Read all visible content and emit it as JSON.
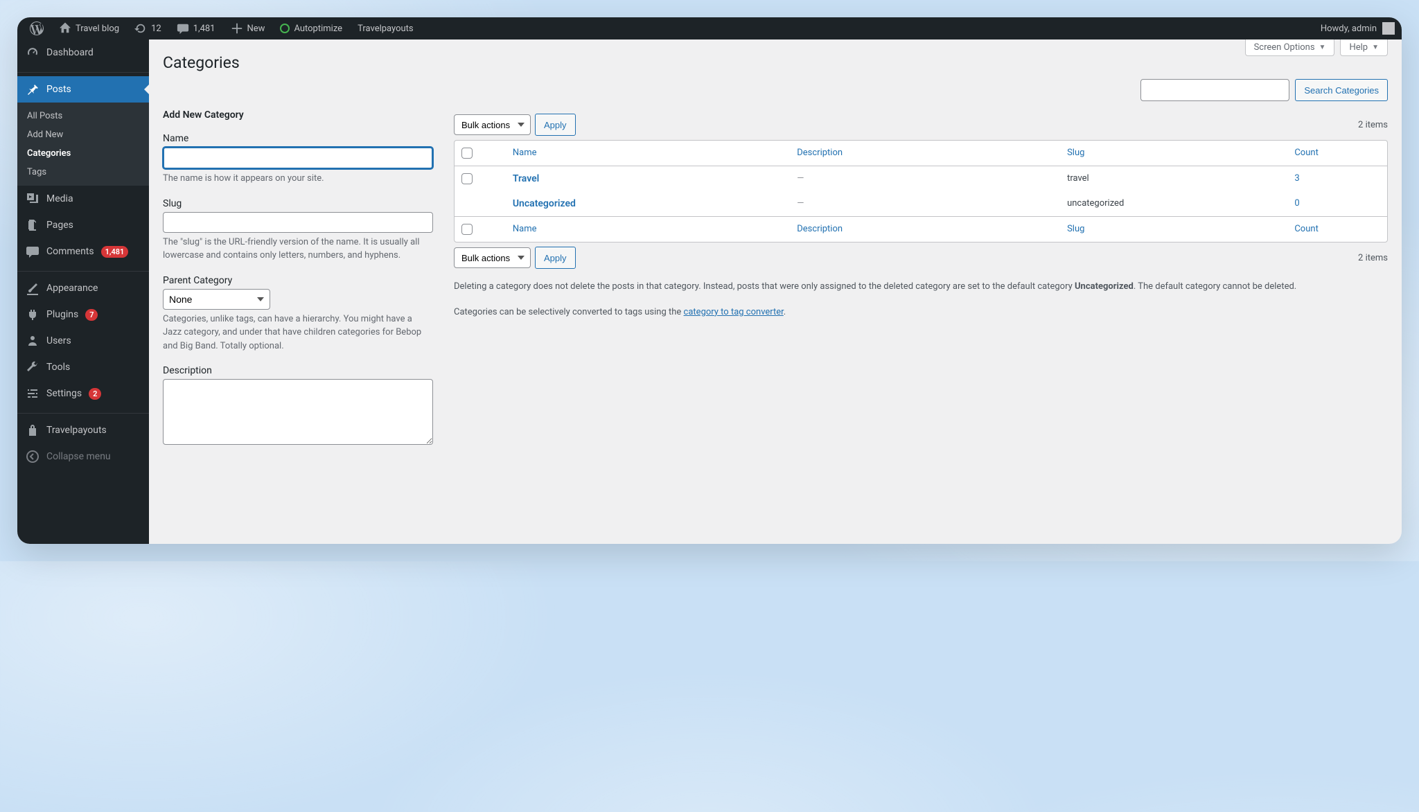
{
  "adminbar": {
    "site_name": "Travel blog",
    "updates_count": "12",
    "comments_count": "1,481",
    "new_label": "New",
    "autoptimize_label": "Autoptimize",
    "travelpayouts_label": "Travelpayouts",
    "howdy": "Howdy, admin"
  },
  "sidebar": {
    "dashboard": "Dashboard",
    "posts": "Posts",
    "posts_submenu": {
      "all": "All Posts",
      "add": "Add New",
      "categories": "Categories",
      "tags": "Tags"
    },
    "media": "Media",
    "pages": "Pages",
    "comments": "Comments",
    "comments_count": "1,481",
    "appearance": "Appearance",
    "plugins": "Plugins",
    "plugins_count": "7",
    "users": "Users",
    "tools": "Tools",
    "settings": "Settings",
    "settings_count": "2",
    "travelpayouts": "Travelpayouts",
    "collapse": "Collapse menu"
  },
  "screen_options": "Screen Options",
  "help": "Help",
  "page_title": "Categories",
  "search_button": "Search Categories",
  "form": {
    "heading": "Add New Category",
    "name_label": "Name",
    "name_desc": "The name is how it appears on your site.",
    "slug_label": "Slug",
    "slug_desc": "The \"slug\" is the URL-friendly version of the name. It is usually all lowercase and contains only letters, numbers, and hyphens.",
    "parent_label": "Parent Category",
    "parent_selected": "None",
    "parent_desc": "Categories, unlike tags, can have a hierarchy. You might have a Jazz category, and under that have children categories for Bebop and Big Band. Totally optional.",
    "desc_label": "Description"
  },
  "bulk_label": "Bulk actions",
  "apply_label": "Apply",
  "items_count": "2 items",
  "columns": {
    "name": "Name",
    "description": "Description",
    "slug": "Slug",
    "count": "Count"
  },
  "rows": [
    {
      "name": "Travel",
      "description": "—",
      "slug": "travel",
      "count": "3",
      "has_checkbox": true
    },
    {
      "name": "Uncategorized",
      "description": "—",
      "slug": "uncategorized",
      "count": "0",
      "has_checkbox": false
    }
  ],
  "note1_a": "Deleting a category does not delete the posts in that category. Instead, posts that were only assigned to the deleted category are set to the default category ",
  "note1_b": "Uncategorized",
  "note1_c": ". The default category cannot be deleted.",
  "note2_a": "Categories can be selectively converted to tags using the ",
  "note2_link": "category to tag converter",
  "note2_b": "."
}
